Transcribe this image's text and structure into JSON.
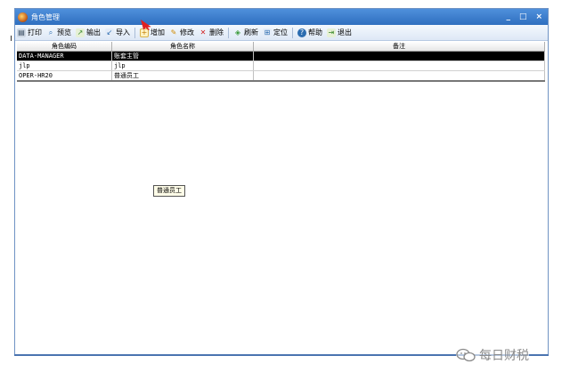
{
  "window": {
    "title": "角色管理",
    "controls": {
      "minimize": "_",
      "maximize": "□",
      "close": "×"
    }
  },
  "toolbar": {
    "items": [
      {
        "label": "打印",
        "icon": "printer-icon"
      },
      {
        "label": "预览",
        "icon": "preview-icon"
      },
      {
        "label": "输出",
        "icon": "export-icon"
      },
      {
        "label": "导入",
        "icon": "import-icon"
      },
      {
        "label": "增加",
        "icon": "add-icon"
      },
      {
        "label": "修改",
        "icon": "edit-icon"
      },
      {
        "label": "删除",
        "icon": "delete-icon"
      },
      {
        "label": "刷新",
        "icon": "refresh-icon"
      },
      {
        "label": "定位",
        "icon": "locate-icon"
      },
      {
        "label": "帮助",
        "icon": "help-icon"
      },
      {
        "label": "退出",
        "icon": "exit-icon"
      }
    ]
  },
  "table": {
    "headers": [
      "角色编码",
      "角色名称",
      "备注"
    ],
    "rows": [
      [
        "DATA-MANAGER",
        "账套主管",
        ""
      ],
      [
        "jlp",
        "jlp",
        ""
      ],
      [
        "OPER-HR20",
        "普通员工",
        ""
      ]
    ],
    "selected_row": 0
  },
  "tooltip": {
    "text": "普通员工"
  },
  "watermark": {
    "text": "每日财税"
  },
  "colors": {
    "title_bar": "#3b7dd0",
    "selection": "#000000",
    "pointer_arrow": "#e02020"
  }
}
